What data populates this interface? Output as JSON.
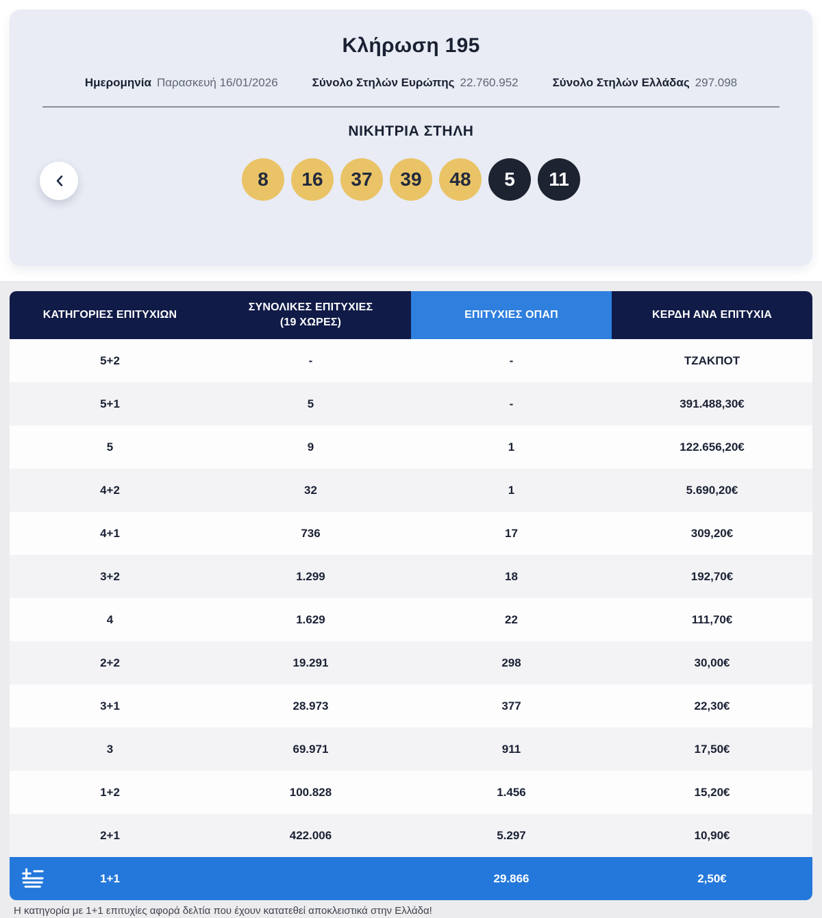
{
  "card": {
    "title": "Κλήρωση 195",
    "meta": [
      {
        "label": "Ημερομηνία",
        "value": "Παρασκευή 16/01/2026"
      },
      {
        "label": "Σύνολο Στηλών Ευρώπης",
        "value": "22.760.952"
      },
      {
        "label": "Σύνολο Στηλών Ελλάδας",
        "value": "297.098"
      }
    ],
    "winning_title": "ΝΙΚΗΤΡΙΑ ΣΤΗΛΗ",
    "numbers_main": [
      "8",
      "16",
      "37",
      "39",
      "48"
    ],
    "numbers_bonus": [
      "5",
      "11"
    ]
  },
  "table": {
    "headers": [
      {
        "lines": [
          "ΚΑΤΗΓΟΡΙΕΣ ΕΠΙΤΥΧΙΩΝ"
        ],
        "highlight": false
      },
      {
        "lines": [
          "ΣΥΝΟΛΙΚΕΣ ΕΠΙΤΥΧΙΕΣ",
          "(19 ΧΩΡΕΣ)"
        ],
        "highlight": false
      },
      {
        "lines": [
          "ΕΠΙΤΥΧΙΕΣ ΟΠΑΠ"
        ],
        "highlight": true
      },
      {
        "lines": [
          "ΚΕΡΔΗ ΑΝΑ ΕΠΙΤΥΧΙΑ"
        ],
        "highlight": false
      }
    ],
    "rows": [
      {
        "category": "5+2",
        "total_wins": "-",
        "opap_wins": "-",
        "prize": "ΤΖΑΚΠΟΤ"
      },
      {
        "category": "5+1",
        "total_wins": "5",
        "opap_wins": "-",
        "prize": "391.488,30€"
      },
      {
        "category": "5",
        "total_wins": "9",
        "opap_wins": "1",
        "prize": "122.656,20€"
      },
      {
        "category": "4+2",
        "total_wins": "32",
        "opap_wins": "1",
        "prize": "5.690,20€"
      },
      {
        "category": "4+1",
        "total_wins": "736",
        "opap_wins": "17",
        "prize": "309,20€"
      },
      {
        "category": "3+2",
        "total_wins": "1.299",
        "opap_wins": "18",
        "prize": "192,70€"
      },
      {
        "category": "4",
        "total_wins": "1.629",
        "opap_wins": "22",
        "prize": "111,70€"
      },
      {
        "category": "2+2",
        "total_wins": "19.291",
        "opap_wins": "298",
        "prize": "30,00€"
      },
      {
        "category": "3+1",
        "total_wins": "28.973",
        "opap_wins": "377",
        "prize": "22,30€"
      },
      {
        "category": "3",
        "total_wins": "69.971",
        "opap_wins": "911",
        "prize": "17,50€"
      },
      {
        "category": "1+2",
        "total_wins": "100.828",
        "opap_wins": "1.456",
        "prize": "15,20€"
      },
      {
        "category": "2+1",
        "total_wins": "422.006",
        "opap_wins": "5.297",
        "prize": "10,90€"
      },
      {
        "category": "1+1",
        "total_wins": "",
        "opap_wins": "29.866",
        "prize": "2,50€",
        "greece_only": true
      }
    ]
  },
  "footnote": "Η κατηγορία με 1+1 επιτυχίες αφορά δελτία που έχουν κατατεθεί αποκλειστικά στην Ελλάδα!",
  "colors": {
    "card_bg": "#E9ECF4",
    "header_navy": "#101B47",
    "header_highlight_blue": "#2E7FDE",
    "total_row_blue": "#2478DB",
    "ball_gold": "#E9C366",
    "ball_dark": "#1D2330",
    "row_alt_gray": "#F3F3F6",
    "section_bg": "#ECECEF"
  }
}
